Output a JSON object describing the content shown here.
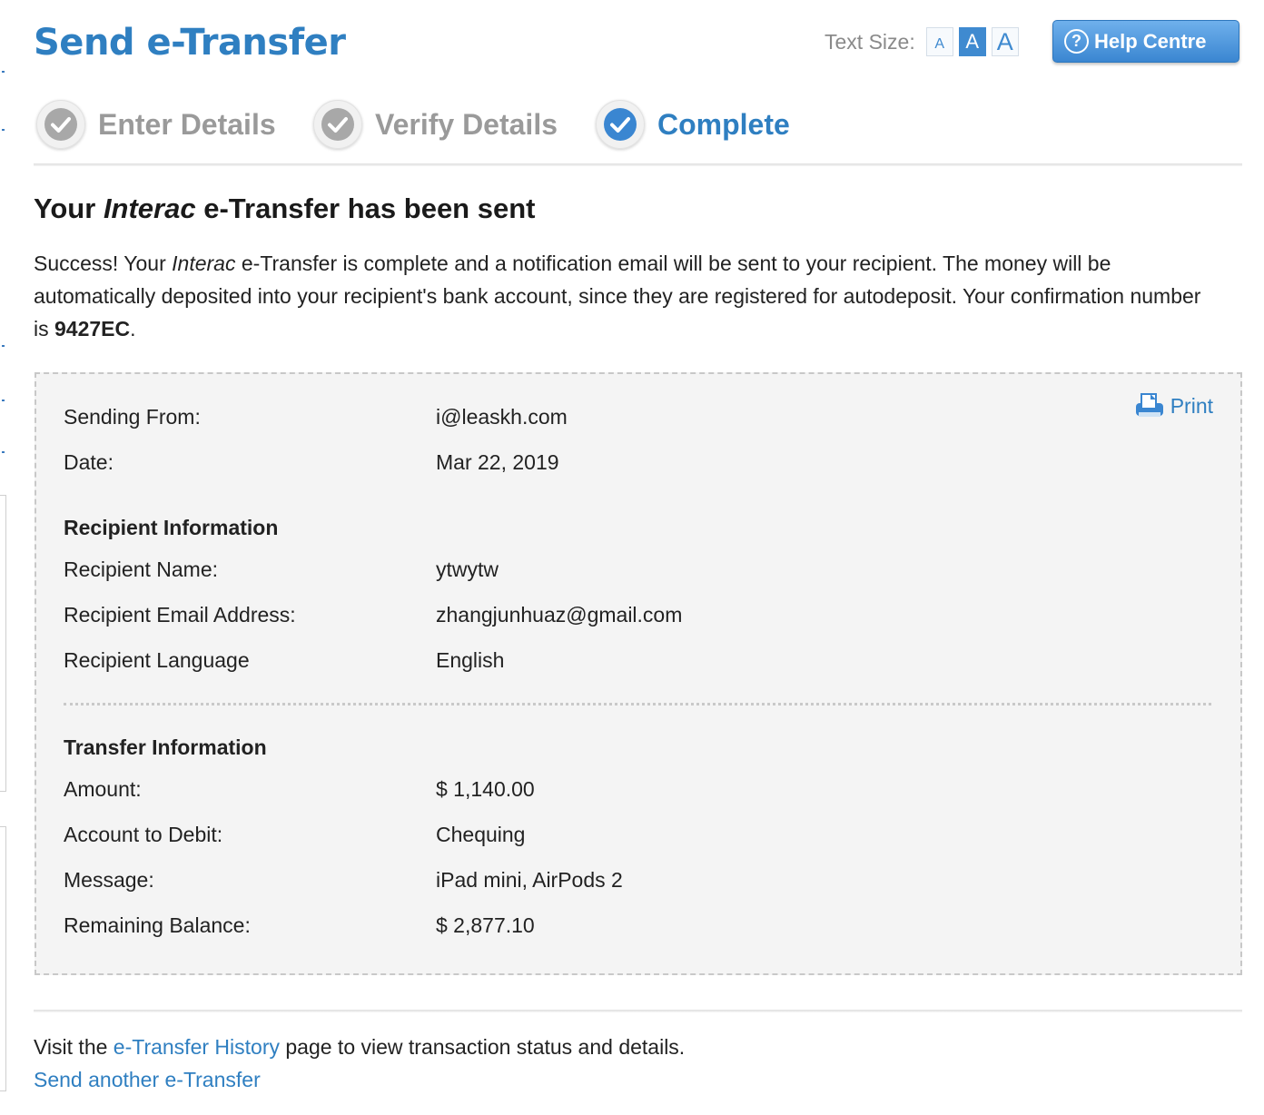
{
  "header": {
    "title": "Send e-Transfer",
    "text_size_label": "Text Size:",
    "text_size_options": [
      "A",
      "A",
      "A"
    ],
    "text_size_selected": "medium",
    "help_button": "Help Centre"
  },
  "steps": [
    {
      "label": "Enter Details",
      "state": "done",
      "icon": "check-icon"
    },
    {
      "label": "Verify Details",
      "state": "done",
      "icon": "check-icon"
    },
    {
      "label": "Complete",
      "state": "active",
      "icon": "check-icon"
    }
  ],
  "confirmation": {
    "heading_before": "Your ",
    "heading_em": "Interac",
    "heading_after": " e-Transfer has been sent",
    "intro_part1": "Success! Your ",
    "intro_em": "Interac",
    "intro_part2": " e-Transfer is complete and a notification email will be sent to your recipient. The money will be automatically deposited into your recipient's bank account, since they are registered for autodeposit. Your confirmation number is ",
    "confirmation_number": "9427EC",
    "intro_end": "."
  },
  "details": {
    "print_label": "Print",
    "sending_from_label": "Sending From:",
    "sending_from": "i@leaskh.com",
    "date_label": "Date:",
    "date": "Mar 22, 2019",
    "recipient_section": "Recipient Information",
    "recipient_name_label": "Recipient Name:",
    "recipient_name": "ytwytw",
    "recipient_email_label": "Recipient Email Address:",
    "recipient_email": "zhangjunhuaz@gmail.com",
    "recipient_language_label": "Recipient Language",
    "recipient_language": "English",
    "transfer_section": "Transfer Information",
    "amount_label": "Amount:",
    "amount": "$ 1,140.00",
    "account_label": "Account to Debit:",
    "account": "Chequing",
    "message_label": "Message:",
    "message": "iPad mini, AirPods 2",
    "balance_label": "Remaining Balance:",
    "balance": "$ 2,877.10"
  },
  "footer": {
    "visit_before": "Visit the ",
    "history_link": "e-Transfer History",
    "visit_after": " page to view transaction status and details.",
    "send_another": "Send another e-Transfer"
  },
  "colors": {
    "brand_blue": "#2f7fc1",
    "inactive_step": "#9a9a9a",
    "panel_bg": "#f4f4f4"
  }
}
